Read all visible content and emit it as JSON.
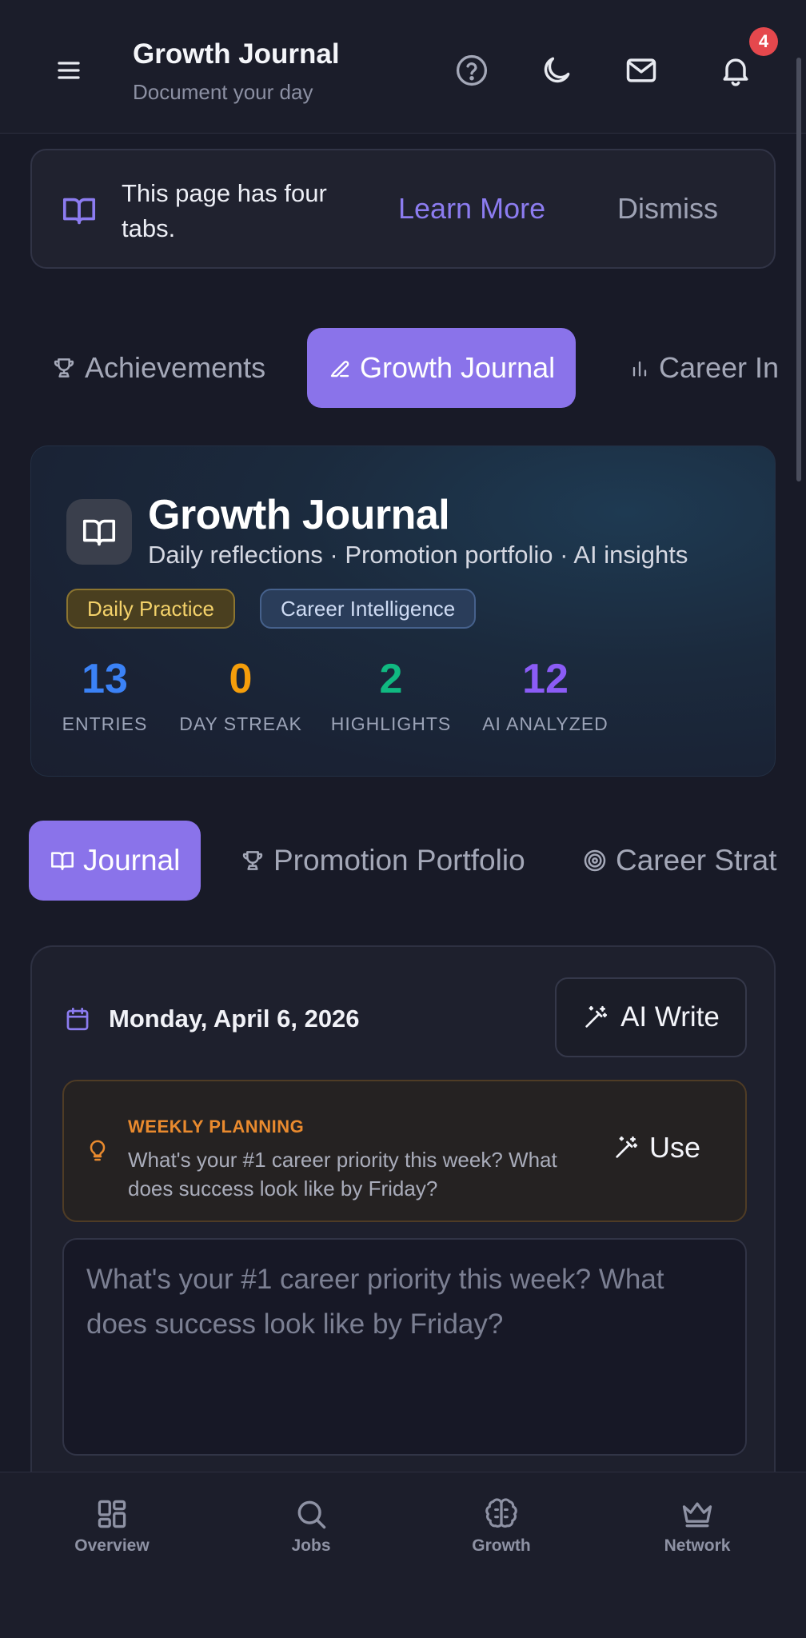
{
  "header": {
    "title": "Growth Journal",
    "subtitle": "Document your day",
    "notification_count": "4"
  },
  "banner": {
    "text": "This page has four tabs.",
    "learn_more": "Learn More",
    "dismiss": "Dismiss"
  },
  "top_tabs": [
    {
      "label": "Achievements",
      "icon": "trophy-icon",
      "active": false
    },
    {
      "label": "Growth Journal",
      "icon": "pencil-icon",
      "active": true
    },
    {
      "label": "Career In",
      "icon": "bar-chart-icon",
      "active": false
    }
  ],
  "hero": {
    "title": "Growth Journal",
    "subtitle": "Daily reflections · Promotion portfolio · AI insights",
    "chips": [
      "Daily Practice",
      "Career Intelligence"
    ],
    "stats": [
      {
        "value": "13",
        "label": "ENTRIES",
        "color": "#3b82f6"
      },
      {
        "value": "0",
        "label": "DAY STREAK",
        "color": "#f59e0b"
      },
      {
        "value": "2",
        "label": "HIGHLIGHTS",
        "color": "#10b981"
      },
      {
        "value": "12",
        "label": "AI ANALYZED",
        "color": "#8b5cf6"
      }
    ]
  },
  "sub_tabs": [
    {
      "label": "Journal",
      "icon": "book-icon",
      "active": true
    },
    {
      "label": "Promotion Portfolio",
      "icon": "trophy-icon",
      "active": false
    },
    {
      "label": "Career Strat",
      "icon": "target-icon",
      "active": false
    }
  ],
  "journal": {
    "date": "Monday, April 6, 2026",
    "ai_write": "AI Write",
    "prompt": {
      "label": "WEEKLY PLANNING",
      "text": "What's your #1 career priority this week? What does success look like by Friday?",
      "use": "Use"
    },
    "entry_placeholder": "What's your #1 career priority this week? What does success look like by Friday?"
  },
  "bottom_nav": [
    {
      "label": "Overview",
      "icon": "grid-icon"
    },
    {
      "label": "Jobs",
      "icon": "search-icon"
    },
    {
      "label": "Growth",
      "icon": "brain-icon"
    },
    {
      "label": "Network",
      "icon": "crown-icon"
    }
  ],
  "colors": {
    "accent": "#8a73ea",
    "background": "#181a27",
    "badge": "#e5484d"
  }
}
